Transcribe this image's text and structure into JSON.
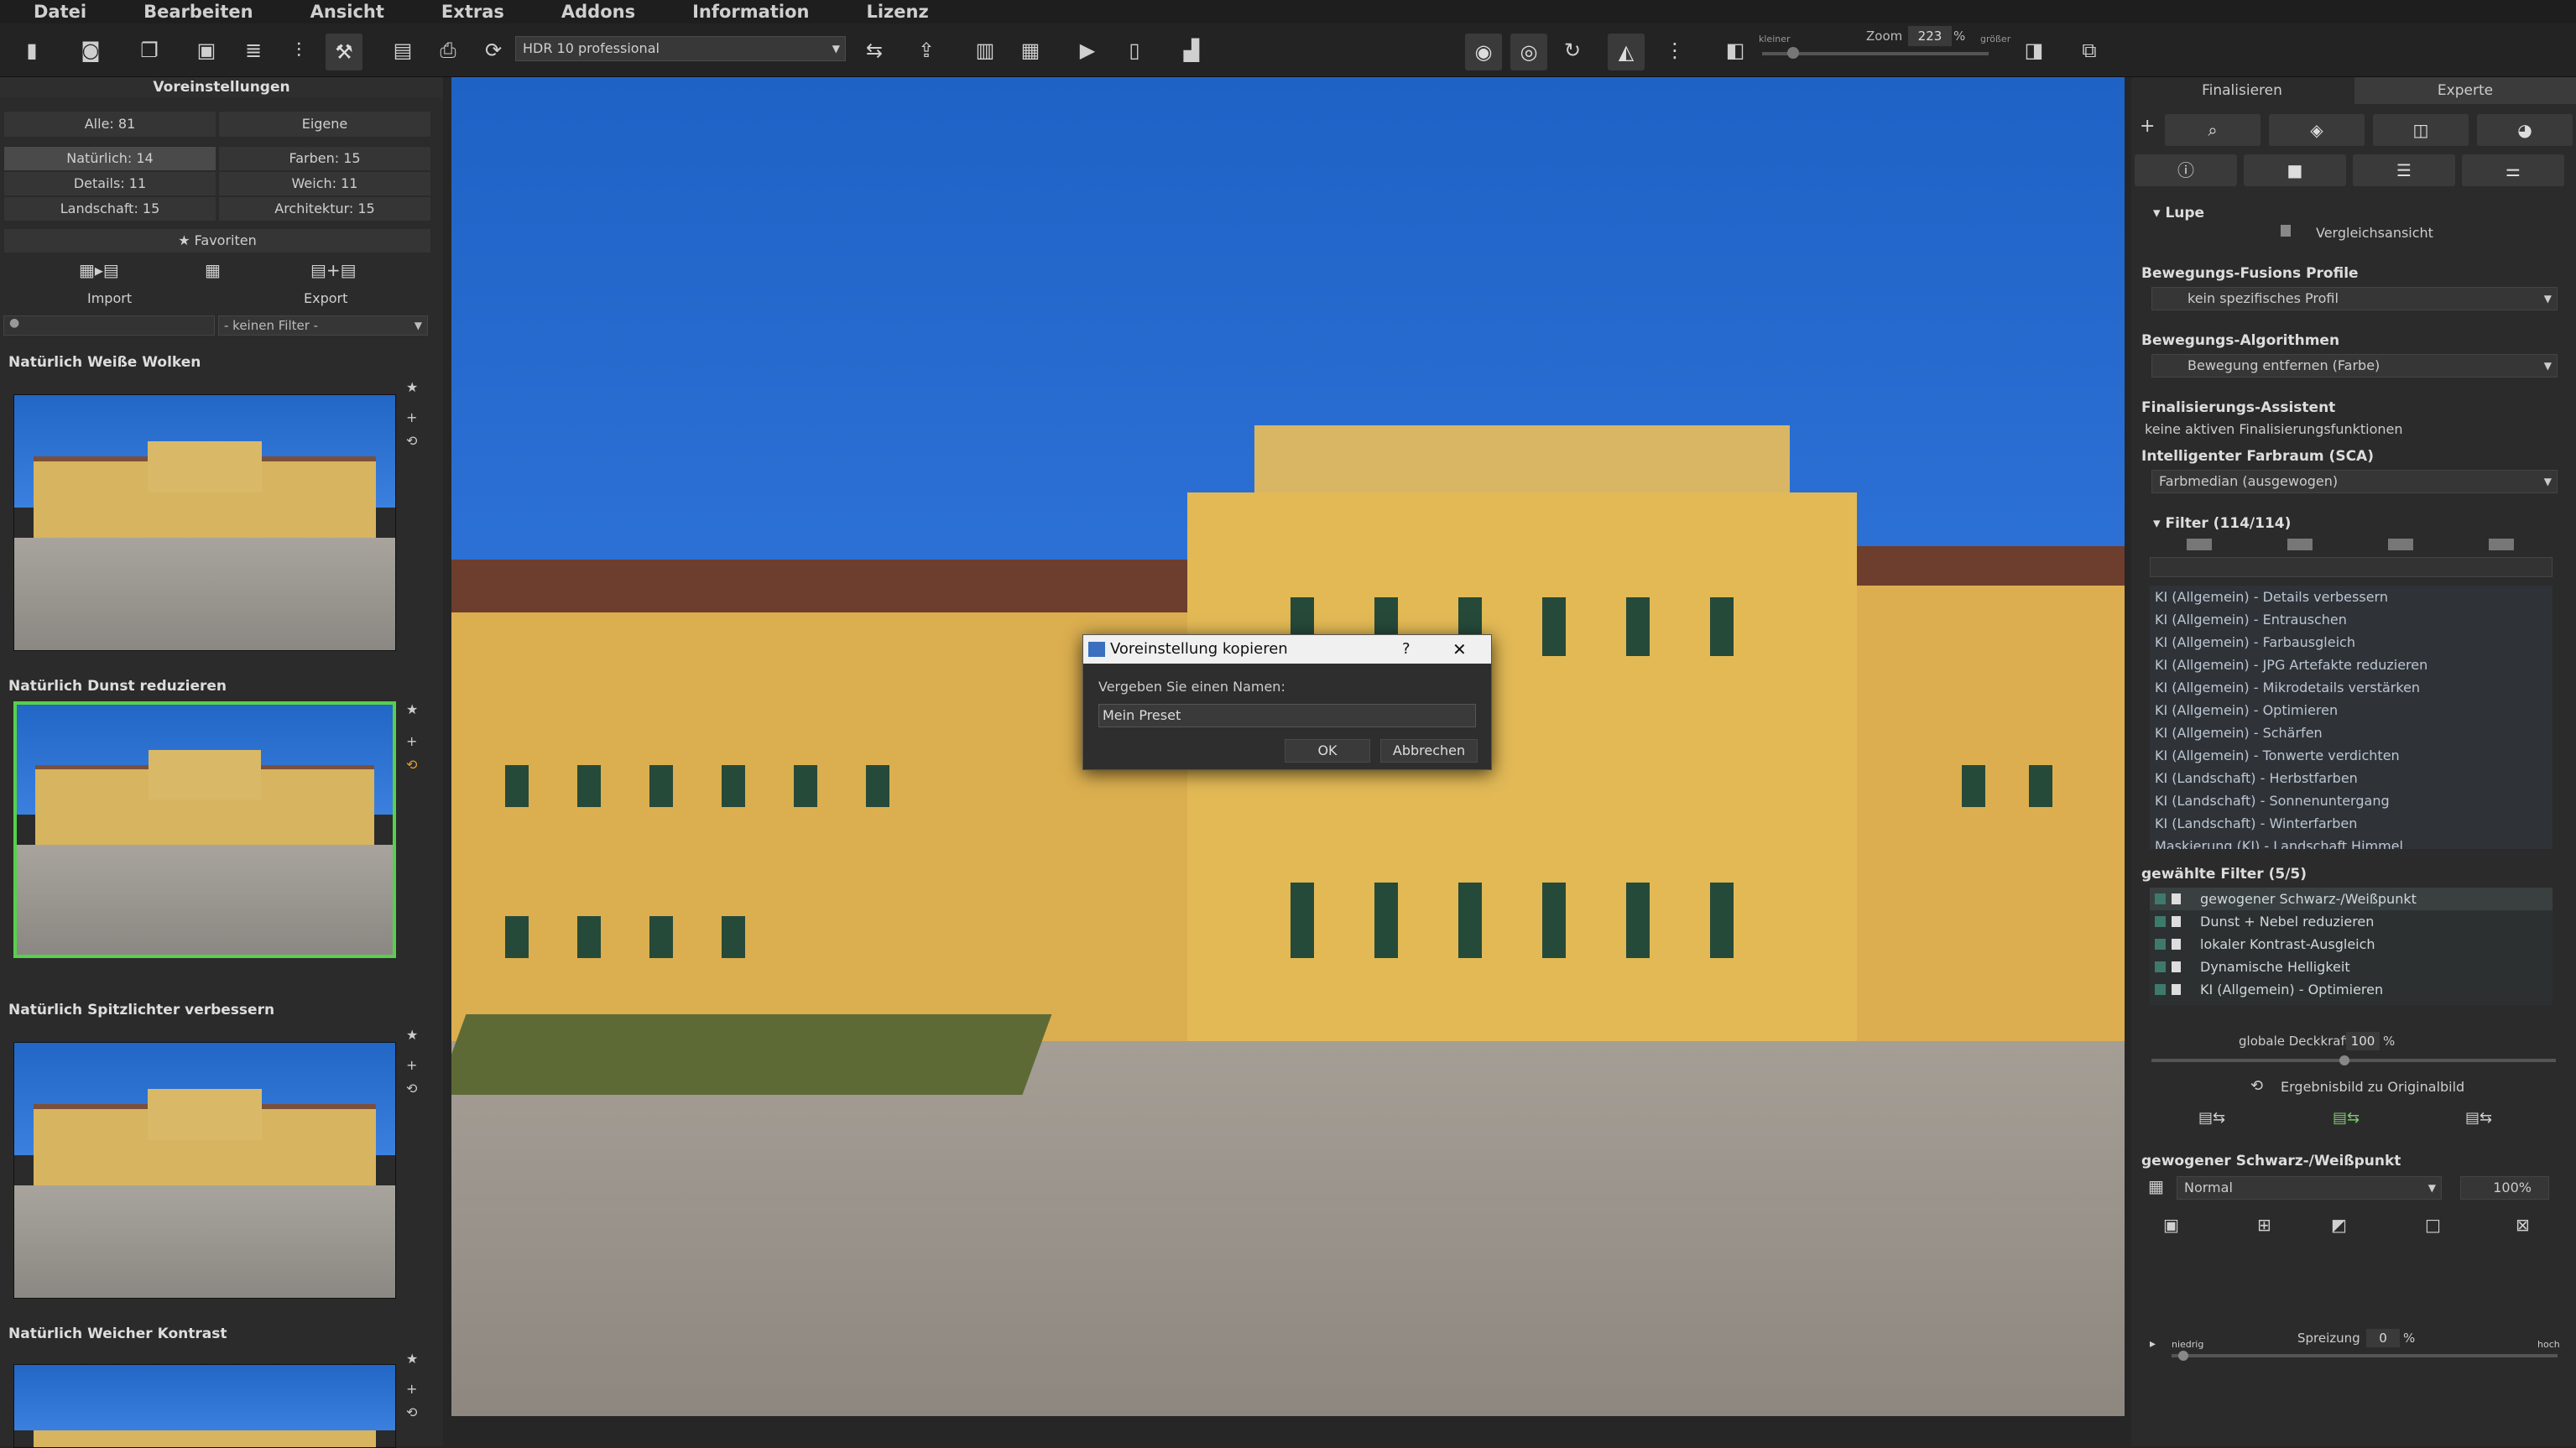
{
  "menu": [
    "Datei",
    "Bearbeiten",
    "Ansicht",
    "Extras",
    "Addons",
    "Information",
    "Lizenz"
  ],
  "toolbar": {
    "preset": "HDR 10 professional",
    "zoom_label": "Zoom",
    "zoom_value": "223",
    "zoom_unit": "%",
    "zoom_small": "kleiner",
    "zoom_big": "größer"
  },
  "left": {
    "title": "Voreinstellungen",
    "all": "Alle: 81",
    "own": "Eigene",
    "natural": "Natürlich: 14",
    "colors": "Farben: 15",
    "details": "Details: 11",
    "soft": "Weich: 11",
    "landscape": "Landschaft: 15",
    "architecture": "Architektur: 15",
    "favorites": "★ Favoriten",
    "import": "Import",
    "export": "Export",
    "filter": "- keinen Filter -",
    "presets": [
      {
        "name": "Natürlich Weiße Wolken"
      },
      {
        "name": "Natürlich Dunst reduzieren"
      },
      {
        "name": "Natürlich Spitzlichter verbessern"
      },
      {
        "name": "Natürlich Weicher Kontrast"
      }
    ]
  },
  "dialog": {
    "title": "Voreinstellung kopieren",
    "help": "?",
    "close": "✕",
    "label": "Vergeben Sie einen Namen:",
    "value": "Mein Preset",
    "ok": "OK",
    "cancel": "Abbrechen"
  },
  "right": {
    "tab_finalize": "Finalisieren",
    "tab_expert": "Experte",
    "plus": "+",
    "minus": "−",
    "lupe": "Lupe",
    "compare": "Vergleichsansicht",
    "fusion_title": "Bewegungs-Fusions Profile",
    "fusion_value": "kein spezifisches Profil",
    "algo_title": "Bewegungs-Algorithmen",
    "algo_value": "Bewegung entfernen (Farbe)",
    "assist_title": "Finalisierungs-Assistent",
    "assist_value": "keine aktiven Finalisierungsfunktionen",
    "sca_title": "Intelligenter Farbraum (SCA)",
    "sca_value": "Farbmedian (ausgewogen)",
    "filter_title": "Filter (114/114)",
    "filters": [
      "KI (Allgemein) - Details verbessern",
      "KI (Allgemein) - Entrauschen",
      "KI (Allgemein) - Farbausgleich",
      "KI (Allgemein) - JPG Artefakte reduzieren",
      "KI (Allgemein) - Mikrodetails verstärken",
      "KI (Allgemein) - Optimieren",
      "KI (Allgemein) - Schärfen",
      "KI (Allgemein) - Tonwerte verdichten",
      "KI (Landschaft) - Herbstfarben",
      "KI (Landschaft) - Sonnenuntergang",
      "KI (Landschaft) - Winterfarben",
      "Maskierung (KI) - Landschaft Himmel"
    ],
    "selected_title": "gewählte Filter (5/5)",
    "selected": [
      "gewogener Schwarz-/Weißpunkt",
      "Dunst + Nebel reduzieren",
      "lokaler Kontrast-Ausgleich",
      "Dynamische Helligkeit",
      "KI (Allgemein) - Optimieren"
    ],
    "opacity_label": "globale Deckkraft",
    "opacity_value": "100",
    "opacity_unit": "%",
    "result_label": "Ergebnisbild zu Originalbild",
    "wb_title": "gewogener Schwarz-/Weißpunkt",
    "blend_mode": "Normal",
    "blend_value": "100%",
    "spread_label": "Spreizung",
    "spread_value": "0",
    "spread_unit": "%",
    "low": "niedrig",
    "high": "hoch"
  }
}
